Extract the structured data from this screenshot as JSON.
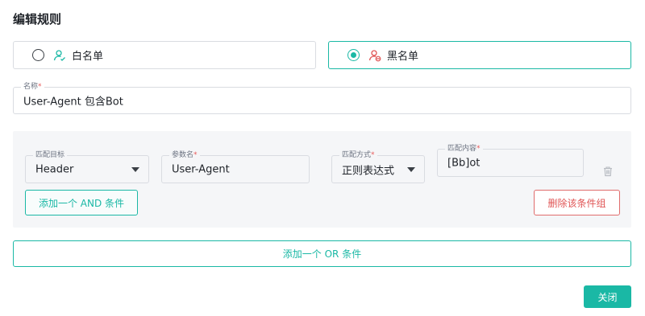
{
  "dialog": {
    "title": "编辑规则"
  },
  "list_types": [
    {
      "label": "白名单",
      "icon": "user-check-icon",
      "selected": false
    },
    {
      "label": "黑名单",
      "icon": "user-block-icon",
      "selected": true
    }
  ],
  "name_field": {
    "label": "名称",
    "required_mark": "*",
    "value": "User-Agent 包含Bot"
  },
  "condition_group": {
    "target": {
      "label": "匹配目标",
      "value": "Header"
    },
    "param": {
      "label": "参数名",
      "required_mark": "*",
      "value": "User-Agent"
    },
    "method": {
      "label": "匹配方式",
      "required_mark": "*",
      "value": "正则表达式"
    },
    "content": {
      "label": "匹配内容",
      "required_mark": "*",
      "value": "[Bb]ot"
    },
    "add_and_label": "添加一个 AND 条件",
    "delete_group_label": "删除该条件组"
  },
  "add_or_label": "添加一个 OR 条件",
  "close_label": "关闭",
  "colors": {
    "accent": "#1ab8a5",
    "danger": "#e05555",
    "border": "#d9dce1",
    "group_bg": "#f5f6f8"
  }
}
